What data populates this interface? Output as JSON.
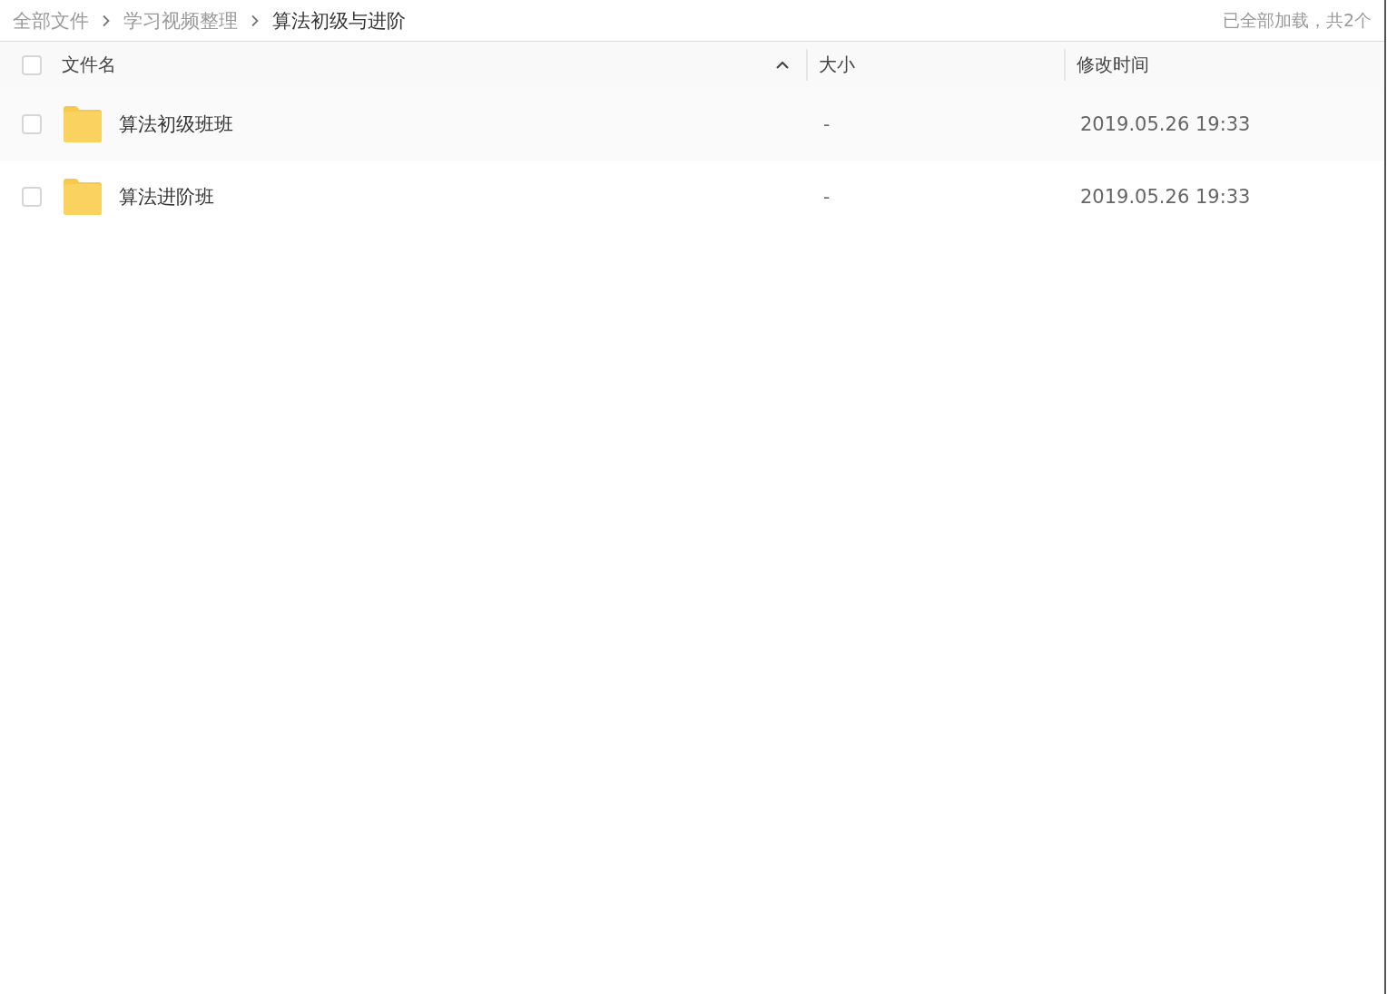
{
  "breadcrumb": [
    {
      "label": "全部文件",
      "current": false
    },
    {
      "label": "学习视频整理",
      "current": false
    },
    {
      "label": "算法初级与进阶",
      "current": true
    }
  ],
  "load_status": "已全部加载，共2个",
  "table": {
    "select_all": {
      "checked": false
    },
    "columns": [
      {
        "label": "文件名",
        "sorted": true
      },
      {
        "label": "大小",
        "sorted": false
      },
      {
        "label": "修改时间",
        "sorted": false
      }
    ],
    "rows": [
      {
        "kind": "folder",
        "name": "算法初级班班",
        "size": "-",
        "modified": "2019.05.26 19:33",
        "checked": false
      },
      {
        "kind": "folder",
        "name": "算法进阶班",
        "size": "-",
        "modified": "2019.05.26 19:33",
        "checked": false
      }
    ]
  }
}
